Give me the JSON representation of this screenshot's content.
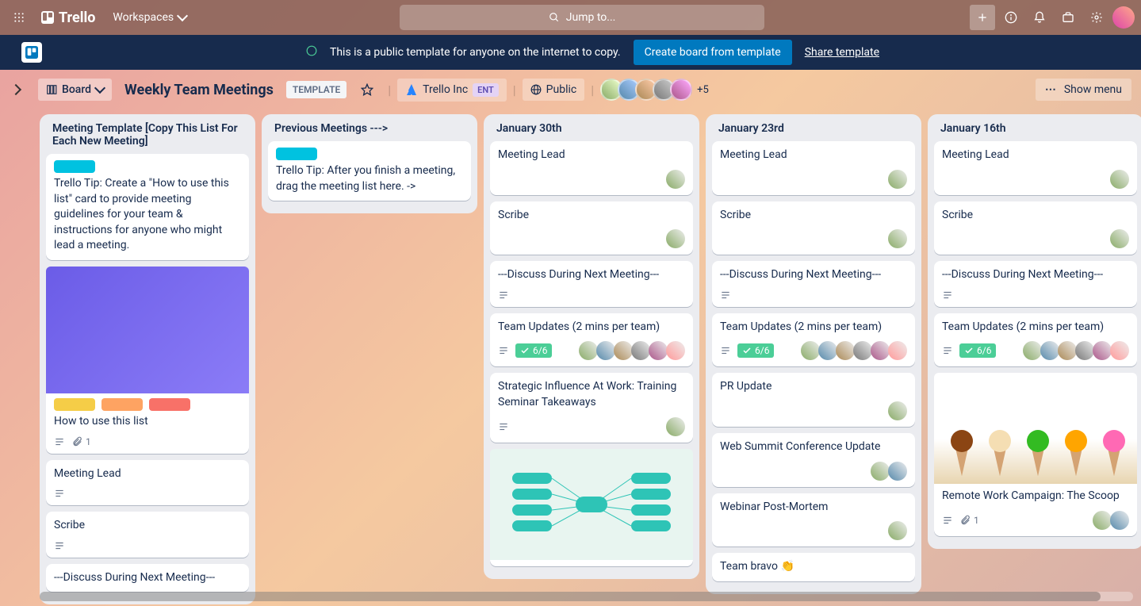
{
  "topbar": {
    "logo": "Trello",
    "workspaces": "Workspaces",
    "search_placeholder": "Jump to..."
  },
  "banner": {
    "message": "This is a public template for anyone on the internet to copy.",
    "create_btn": "Create board from template",
    "share_link": "Share template"
  },
  "header": {
    "view_label": "Board",
    "board_title": "Weekly Team Meetings",
    "template_badge": "TEMPLATE",
    "org": "Trello Inc",
    "ent_badge": "ENT",
    "visibility": "Public",
    "more_members": "+5",
    "show_menu": "Show menu"
  },
  "colors": {
    "cyan": "#00c2e0",
    "yellow": "#f5cd47",
    "orange": "#fea362",
    "red": "#f87168",
    "green_check": "#4bce97"
  },
  "lists": [
    {
      "title": "Meeting Template [Copy This List For Each New Meeting]",
      "cards": [
        {
          "labels": [
            "cyan"
          ],
          "text": "Trello Tip: Create a \"How to use this list\" card to provide meeting guidelines for your team & instructions for anyone who might lead a meeting."
        },
        {
          "cover": "blue",
          "labels": [
            "yellow",
            "orange",
            "red"
          ],
          "text": "How to use this list",
          "desc": true,
          "attach": "1"
        },
        {
          "text": "Meeting Lead",
          "desc": true
        },
        {
          "text": "Scribe",
          "desc": true
        },
        {
          "text": "---Discuss During Next Meeting---"
        }
      ]
    },
    {
      "title": "Previous Meetings --->",
      "cards": [
        {
          "labels": [
            "cyan"
          ],
          "text": "Trello Tip: After you finish a meeting, drag the meeting list here. ->"
        }
      ]
    },
    {
      "title": "January 30th",
      "cards": [
        {
          "text": "Meeting Lead",
          "members": 1
        },
        {
          "text": "Scribe",
          "members": 1
        },
        {
          "text": "---Discuss During Next Meeting---",
          "desc": true
        },
        {
          "text": "Team Updates (2 mins per team)",
          "desc": true,
          "checklist": "6/6",
          "members": 6
        },
        {
          "text": "Strategic Influence At Work: Training Seminar Takeaways",
          "desc": true,
          "members": 1
        },
        {
          "cover": "green",
          "text": ""
        }
      ]
    },
    {
      "title": "January 23rd",
      "cards": [
        {
          "text": "Meeting Lead",
          "members": 1
        },
        {
          "text": "Scribe",
          "members": 1
        },
        {
          "text": "---Discuss During Next Meeting---",
          "desc": true
        },
        {
          "text": "Team Updates (2 mins per team)",
          "desc": true,
          "checklist": "6/6",
          "members": 6
        },
        {
          "text": "PR Update",
          "members": 1
        },
        {
          "text": "Web Summit Conference Update",
          "members": 2
        },
        {
          "text": "Webinar Post-Mortem",
          "members": 1
        },
        {
          "text": "Team bravo 👏"
        }
      ]
    },
    {
      "title": "January 16th",
      "cards": [
        {
          "text": "Meeting Lead",
          "members": 1
        },
        {
          "text": "Scribe",
          "members": 1
        },
        {
          "text": "---Discuss During Next Meeting---",
          "desc": true
        },
        {
          "text": "Team Updates (2 mins per team)",
          "desc": true,
          "checklist": "6/6",
          "members": 6
        },
        {
          "cover": "cones",
          "text": "Remote Work Campaign: The Scoop",
          "desc": true,
          "attach": "1",
          "members": 2
        }
      ]
    }
  ]
}
